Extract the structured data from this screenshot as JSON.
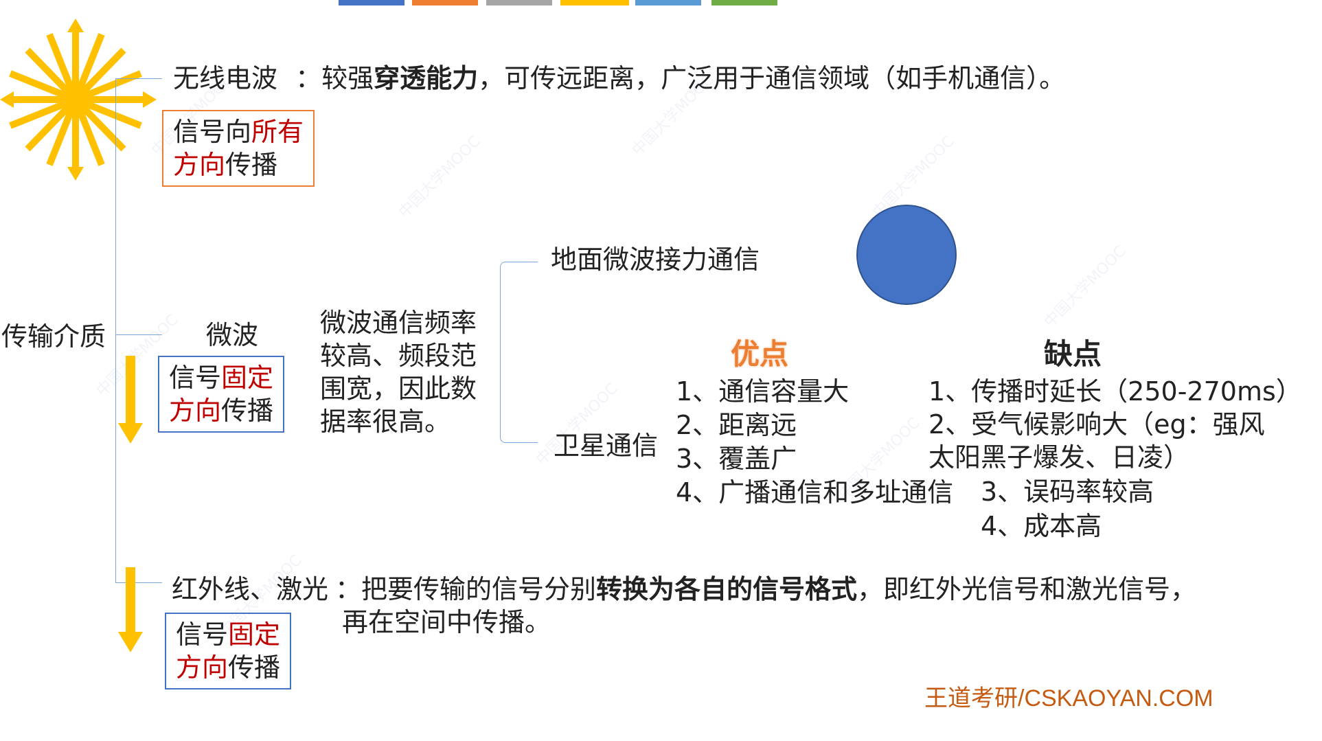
{
  "topbar_colors": [
    "#4472c4",
    "#ed7d31",
    "#a5a5a5",
    "#ffc000",
    "#5b9bd5",
    "#70ad47"
  ],
  "root_label": "传输介质",
  "radio": {
    "label": "无线电波",
    "sep": "：较强",
    "bold": "穿透能力",
    "desc_rest": "，可传远距离，广泛用于通信领域（如手机通信）。",
    "box_line1_a": "信号向",
    "box_line1_b": "所有",
    "box_line2_a": "方向",
    "box_line2_b": "传播"
  },
  "microwave": {
    "label": "微波",
    "box_line1_a": "信号",
    "box_line1_b": "固定",
    "box_line2_a": "方向",
    "box_line2_b": "传播",
    "desc_lines": [
      "微波通信频率",
      "较高、频段范",
      "围宽，因此数",
      "据率很高。"
    ],
    "ground": "地面微波接力通信",
    "satellite": "卫星通信",
    "pros_title": "优点",
    "pros": [
      "1、通信容量大",
      "2、距离远",
      "3、覆盖广",
      "4、广播通信和多址通信"
    ],
    "cons_title": "缺点",
    "cons": [
      "1、传播时延长（250-270ms）",
      "2、受气候影响大（eg：强风",
      "太阳黑子爆发、日凌）",
      "3、误码率较高",
      "4、成本高"
    ]
  },
  "infrared": {
    "label": "红外线、激光",
    "sep": "：把要传输的信号分别",
    "bold": "转换为各自的信号格式",
    "rest": "，即红外光信号和激光信号，",
    "line2": "再在空间中传播。",
    "box_line1_a": "信号",
    "box_line1_b": "固定",
    "box_line2_a": "方向",
    "box_line2_b": "传播"
  },
  "footer_brand": "王道考研/CSKAOYAN.COM",
  "colors": {
    "accent_red": "#c00000",
    "arrow_yellow": "#ffc000",
    "circle_blue": "#4472c4",
    "pros_orange": "#ed7d31"
  },
  "icons": [
    "starburst-arrows-icon",
    "down-arrow-icon",
    "down-arrow-icon",
    "blue-circle-icon"
  ]
}
